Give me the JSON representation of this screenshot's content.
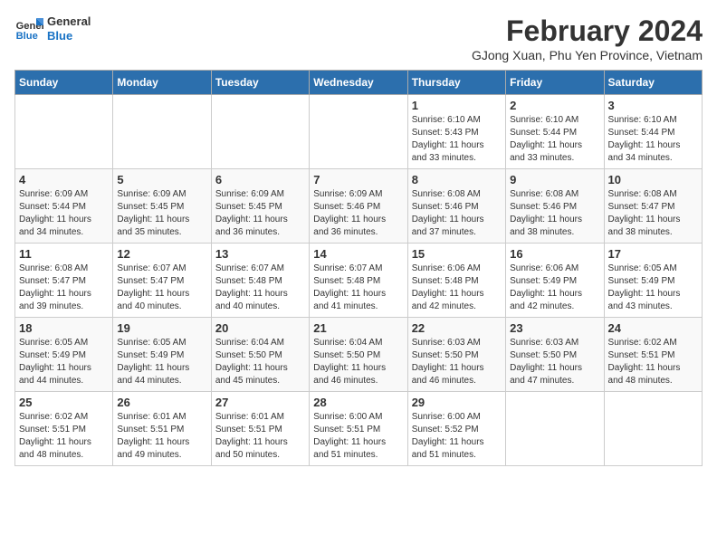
{
  "logo": {
    "text_general": "General",
    "text_blue": "Blue"
  },
  "header": {
    "title": "February 2024",
    "subtitle": "GJong Xuan, Phu Yen Province, Vietnam"
  },
  "weekdays": [
    "Sunday",
    "Monday",
    "Tuesday",
    "Wednesday",
    "Thursday",
    "Friday",
    "Saturday"
  ],
  "weeks": [
    [
      {
        "day": "",
        "info": ""
      },
      {
        "day": "",
        "info": ""
      },
      {
        "day": "",
        "info": ""
      },
      {
        "day": "",
        "info": ""
      },
      {
        "day": "1",
        "info": "Sunrise: 6:10 AM\nSunset: 5:43 PM\nDaylight: 11 hours\nand 33 minutes."
      },
      {
        "day": "2",
        "info": "Sunrise: 6:10 AM\nSunset: 5:44 PM\nDaylight: 11 hours\nand 33 minutes."
      },
      {
        "day": "3",
        "info": "Sunrise: 6:10 AM\nSunset: 5:44 PM\nDaylight: 11 hours\nand 34 minutes."
      }
    ],
    [
      {
        "day": "4",
        "info": "Sunrise: 6:09 AM\nSunset: 5:44 PM\nDaylight: 11 hours\nand 34 minutes."
      },
      {
        "day": "5",
        "info": "Sunrise: 6:09 AM\nSunset: 5:45 PM\nDaylight: 11 hours\nand 35 minutes."
      },
      {
        "day": "6",
        "info": "Sunrise: 6:09 AM\nSunset: 5:45 PM\nDaylight: 11 hours\nand 36 minutes."
      },
      {
        "day": "7",
        "info": "Sunrise: 6:09 AM\nSunset: 5:46 PM\nDaylight: 11 hours\nand 36 minutes."
      },
      {
        "day": "8",
        "info": "Sunrise: 6:08 AM\nSunset: 5:46 PM\nDaylight: 11 hours\nand 37 minutes."
      },
      {
        "day": "9",
        "info": "Sunrise: 6:08 AM\nSunset: 5:46 PM\nDaylight: 11 hours\nand 38 minutes."
      },
      {
        "day": "10",
        "info": "Sunrise: 6:08 AM\nSunset: 5:47 PM\nDaylight: 11 hours\nand 38 minutes."
      }
    ],
    [
      {
        "day": "11",
        "info": "Sunrise: 6:08 AM\nSunset: 5:47 PM\nDaylight: 11 hours\nand 39 minutes."
      },
      {
        "day": "12",
        "info": "Sunrise: 6:07 AM\nSunset: 5:47 PM\nDaylight: 11 hours\nand 40 minutes."
      },
      {
        "day": "13",
        "info": "Sunrise: 6:07 AM\nSunset: 5:48 PM\nDaylight: 11 hours\nand 40 minutes."
      },
      {
        "day": "14",
        "info": "Sunrise: 6:07 AM\nSunset: 5:48 PM\nDaylight: 11 hours\nand 41 minutes."
      },
      {
        "day": "15",
        "info": "Sunrise: 6:06 AM\nSunset: 5:48 PM\nDaylight: 11 hours\nand 42 minutes."
      },
      {
        "day": "16",
        "info": "Sunrise: 6:06 AM\nSunset: 5:49 PM\nDaylight: 11 hours\nand 42 minutes."
      },
      {
        "day": "17",
        "info": "Sunrise: 6:05 AM\nSunset: 5:49 PM\nDaylight: 11 hours\nand 43 minutes."
      }
    ],
    [
      {
        "day": "18",
        "info": "Sunrise: 6:05 AM\nSunset: 5:49 PM\nDaylight: 11 hours\nand 44 minutes."
      },
      {
        "day": "19",
        "info": "Sunrise: 6:05 AM\nSunset: 5:49 PM\nDaylight: 11 hours\nand 44 minutes."
      },
      {
        "day": "20",
        "info": "Sunrise: 6:04 AM\nSunset: 5:50 PM\nDaylight: 11 hours\nand 45 minutes."
      },
      {
        "day": "21",
        "info": "Sunrise: 6:04 AM\nSunset: 5:50 PM\nDaylight: 11 hours\nand 46 minutes."
      },
      {
        "day": "22",
        "info": "Sunrise: 6:03 AM\nSunset: 5:50 PM\nDaylight: 11 hours\nand 46 minutes."
      },
      {
        "day": "23",
        "info": "Sunrise: 6:03 AM\nSunset: 5:50 PM\nDaylight: 11 hours\nand 47 minutes."
      },
      {
        "day": "24",
        "info": "Sunrise: 6:02 AM\nSunset: 5:51 PM\nDaylight: 11 hours\nand 48 minutes."
      }
    ],
    [
      {
        "day": "25",
        "info": "Sunrise: 6:02 AM\nSunset: 5:51 PM\nDaylight: 11 hours\nand 48 minutes."
      },
      {
        "day": "26",
        "info": "Sunrise: 6:01 AM\nSunset: 5:51 PM\nDaylight: 11 hours\nand 49 minutes."
      },
      {
        "day": "27",
        "info": "Sunrise: 6:01 AM\nSunset: 5:51 PM\nDaylight: 11 hours\nand 50 minutes."
      },
      {
        "day": "28",
        "info": "Sunrise: 6:00 AM\nSunset: 5:51 PM\nDaylight: 11 hours\nand 51 minutes."
      },
      {
        "day": "29",
        "info": "Sunrise: 6:00 AM\nSunset: 5:52 PM\nDaylight: 11 hours\nand 51 minutes."
      },
      {
        "day": "",
        "info": ""
      },
      {
        "day": "",
        "info": ""
      }
    ]
  ]
}
